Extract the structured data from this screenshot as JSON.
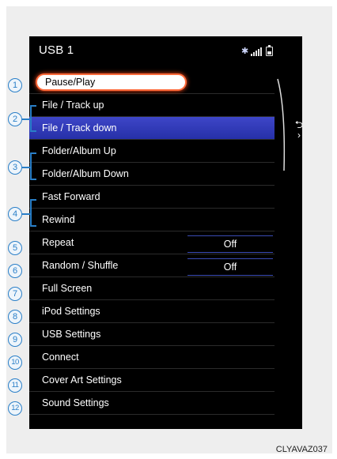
{
  "header": {
    "title": "USB 1",
    "bluetooth_icon": "bluetooth-icon",
    "signal_icon": "signal-strength-icon",
    "battery_icon": "battery-icon"
  },
  "menu": [
    {
      "callout": "1",
      "label": "Pause/Play"
    },
    {
      "callout": "2",
      "label": "File / Track up"
    },
    {
      "callout": "2",
      "label": "File / Track down"
    },
    {
      "callout": "3",
      "label": "Folder/Album Up"
    },
    {
      "callout": "3",
      "label": "Folder/Album Down"
    },
    {
      "callout": "4",
      "label": "Fast Forward"
    },
    {
      "callout": "4",
      "label": "Rewind"
    },
    {
      "callout": "5",
      "label": "Repeat",
      "value": "Off"
    },
    {
      "callout": "6",
      "label": "Random / Shuffle",
      "value": "Off"
    },
    {
      "callout": "7",
      "label": "Full Screen"
    },
    {
      "callout": "8",
      "label": "iPod Settings"
    },
    {
      "callout": "9",
      "label": "USB Settings"
    },
    {
      "callout": "10",
      "label": "Connect"
    },
    {
      "callout": "11",
      "label": "Cover Art Settings"
    },
    {
      "callout": "12",
      "label": "Sound Settings"
    }
  ],
  "side_tab": {
    "icon": "back-arrow-icon"
  },
  "callouts": [
    "1",
    "2",
    "3",
    "4",
    "5",
    "6",
    "7",
    "8",
    "9",
    "10",
    "11",
    "12"
  ],
  "caption": "CLYAVAZ037",
  "colors": {
    "highlight": "#2f38b8",
    "focus_glow": "#ff5a2a",
    "callout": "#2a7fc8"
  }
}
